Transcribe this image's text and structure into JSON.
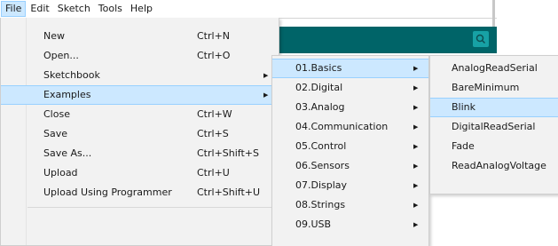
{
  "menubar": {
    "items": [
      "File",
      "Edit",
      "Sketch",
      "Tools",
      "Help"
    ]
  },
  "toolbar": {
    "serial_monitor_icon": "magnifier-icon"
  },
  "file_menu": {
    "items": [
      {
        "label": "New",
        "shortcut": "Ctrl+N"
      },
      {
        "label": "Open...",
        "shortcut": "Ctrl+O"
      },
      {
        "label": "Sketchbook",
        "shortcut": ""
      },
      {
        "label": "Examples",
        "shortcut": ""
      },
      {
        "label": "Close",
        "shortcut": "Ctrl+W"
      },
      {
        "label": "Save",
        "shortcut": "Ctrl+S"
      },
      {
        "label": "Save As...",
        "shortcut": "Ctrl+Shift+S"
      },
      {
        "label": "Upload",
        "shortcut": "Ctrl+U"
      },
      {
        "label": "Upload Using Programmer",
        "shortcut": "Ctrl+Shift+U"
      }
    ]
  },
  "examples_menu": {
    "items": [
      "01.Basics",
      "02.Digital",
      "03.Analog",
      "04.Communication",
      "05.Control",
      "06.Sensors",
      "07.Display",
      "08.Strings",
      "09.USB"
    ]
  },
  "basics_menu": {
    "items": [
      "AnalogReadSerial",
      "BareMinimum",
      "Blink",
      "DigitalReadSerial",
      "Fade",
      "ReadAnalogVoltage"
    ]
  },
  "colors": {
    "highlight": "#cce8ff",
    "highlight_border": "#99d1ff",
    "arduino_teal": "#006468"
  }
}
